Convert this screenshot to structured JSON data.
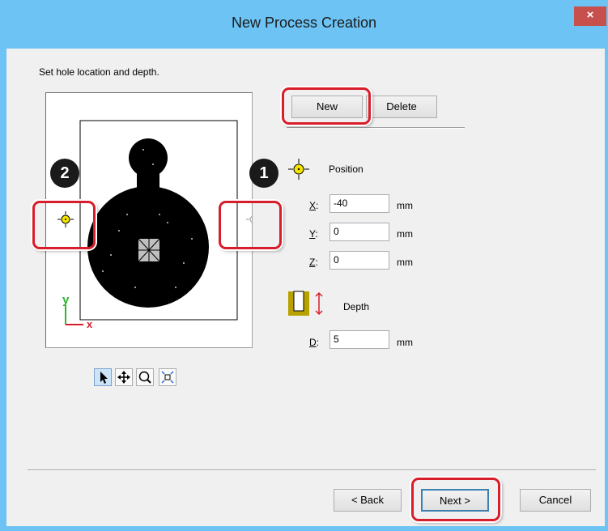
{
  "window": {
    "title": "New Process Creation",
    "close_label": "×"
  },
  "instruction": "Set hole location and depth.",
  "buttons": {
    "new": "New",
    "delete": "Delete",
    "back": "< Back",
    "next": "Next >",
    "cancel": "Cancel"
  },
  "position": {
    "label": "Position",
    "x": {
      "key": "X",
      "sep": ":",
      "value": "-40",
      "unit": "mm"
    },
    "y": {
      "key": "Y",
      "sep": ":",
      "value": "0",
      "unit": "mm"
    },
    "z": {
      "key": "Z",
      "sep": ":",
      "value": "0",
      "unit": "mm"
    }
  },
  "depth": {
    "label": "Depth",
    "d": {
      "key": "D",
      "sep": ":",
      "value": "5",
      "unit": "mm"
    }
  },
  "axes": {
    "y": "y",
    "x": "x"
  },
  "toolbar": [
    "pointer-icon",
    "pan-icon",
    "zoom-icon",
    "fit-view-icon"
  ],
  "callouts": {
    "one": "1",
    "two": "2"
  },
  "colors": {
    "title_bar": "#6cc3f4",
    "close_button": "#c7504d",
    "callout_red": "#d81e2a",
    "marker_yellow": "#f5e400",
    "axis_green": "#2db52d",
    "axis_red": "#d81e2a"
  }
}
